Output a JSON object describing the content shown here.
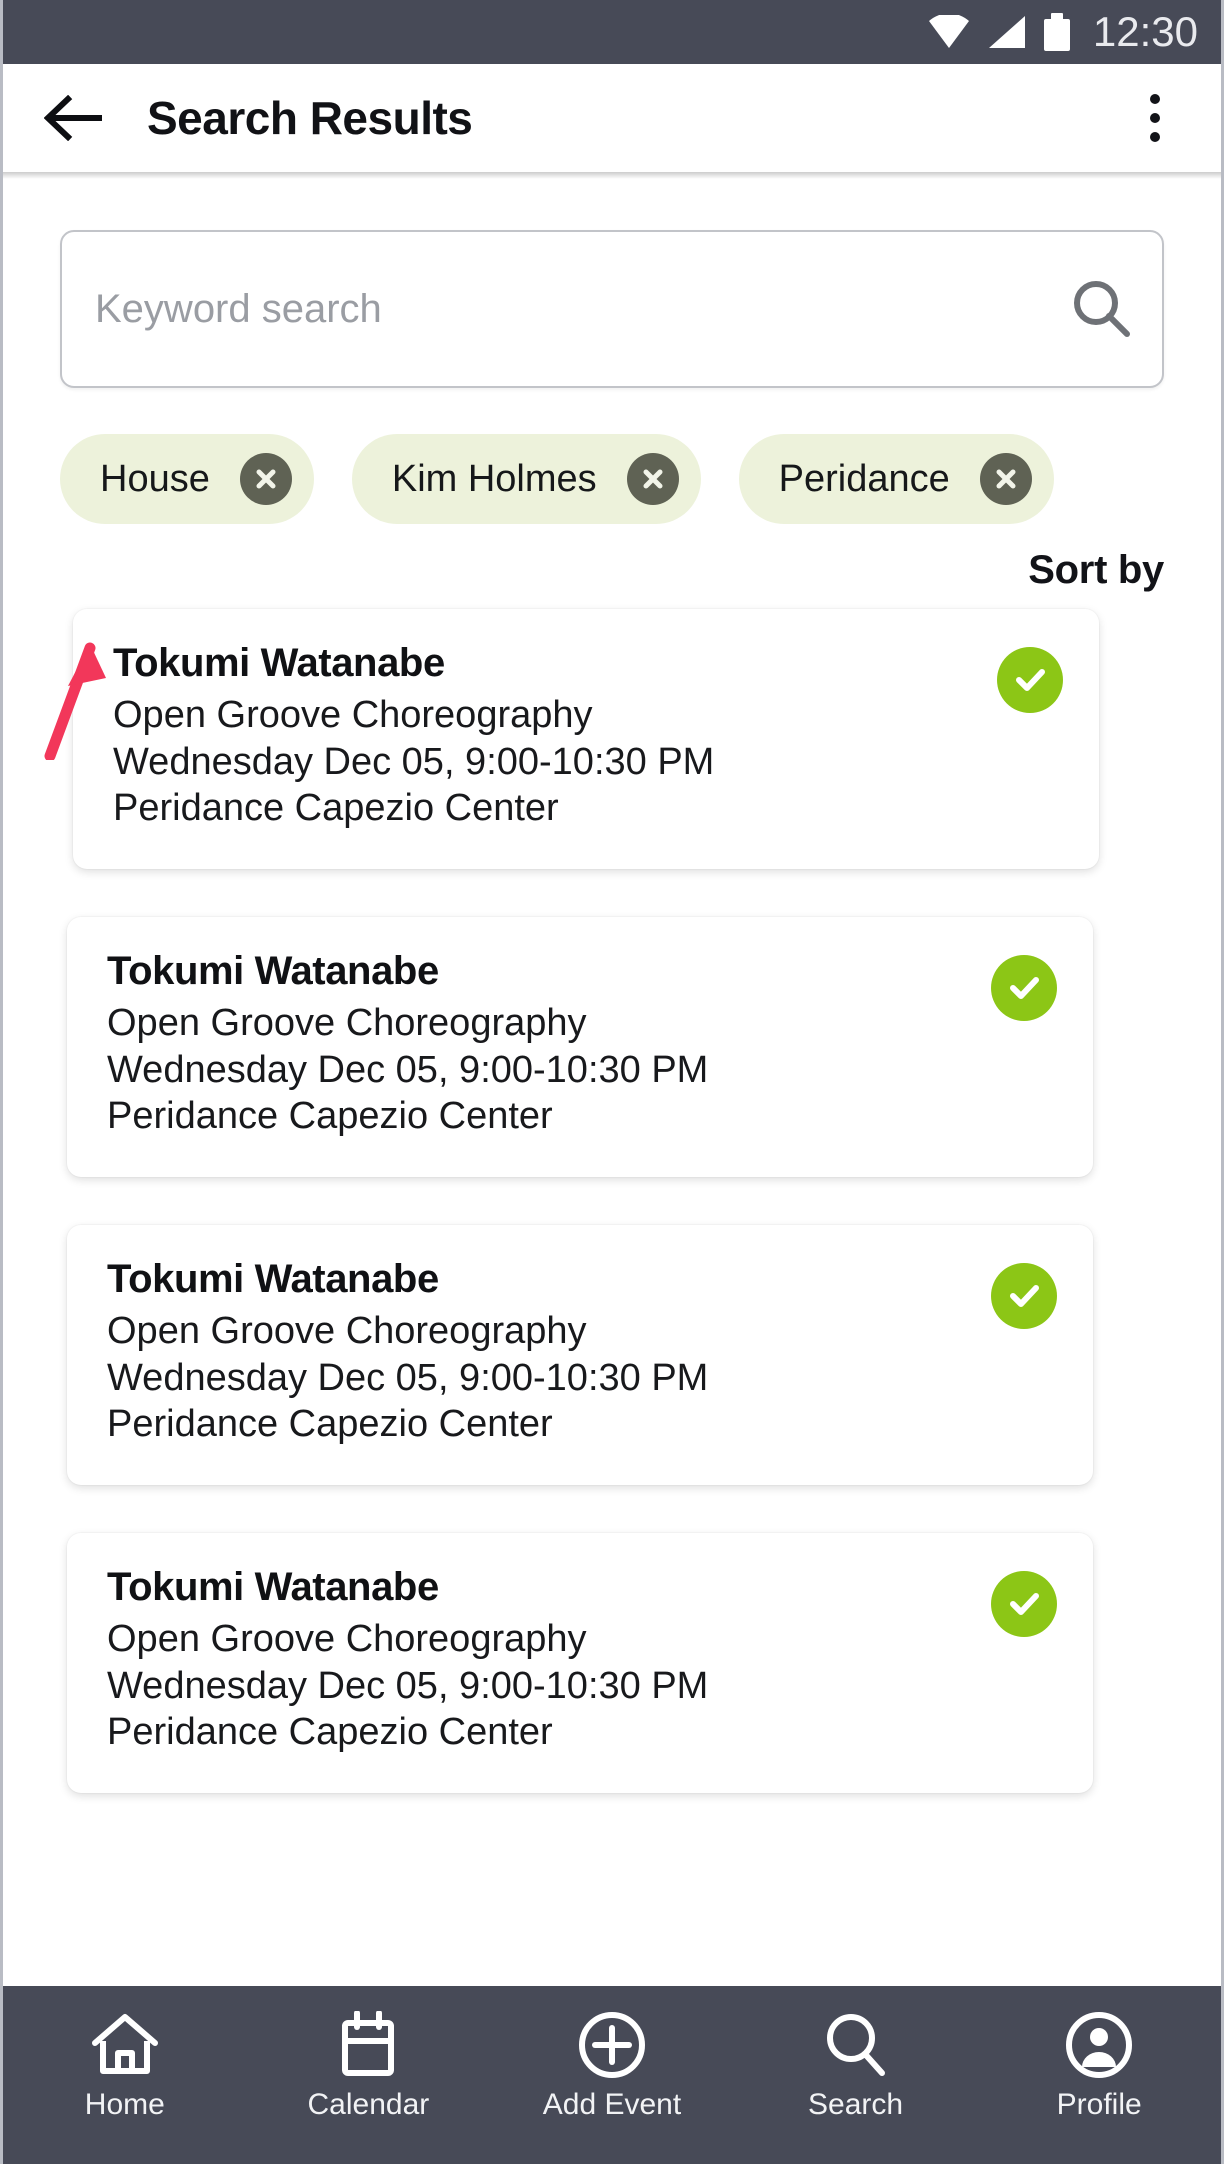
{
  "status_bar": {
    "time": "12:30",
    "icons": [
      "wifi-icon",
      "signal-icon",
      "battery-icon"
    ],
    "background": "#474A57"
  },
  "app_bar": {
    "back_icon": "back-arrow-icon",
    "title": "Search Results",
    "overflow_icon": "more-vertical-icon"
  },
  "search": {
    "placeholder": "Keyword search",
    "value": "",
    "icon": "search-icon"
  },
  "filter_chips": [
    {
      "label": "House",
      "remove_icon": "close-circle-icon"
    },
    {
      "label": "Kim Holmes",
      "remove_icon": "close-circle-icon"
    },
    {
      "label": "Peridance",
      "remove_icon": "close-circle-icon"
    }
  ],
  "sort": {
    "label": "Sort by"
  },
  "annotation": {
    "type": "arrow",
    "color": "#F2375A",
    "points_to": "House filter chip"
  },
  "results": [
    {
      "title": "Tokumi Watanabe",
      "class_name": "Open Groove Choreography",
      "schedule": "Wednesday Dec 05, 9:00-10:30 PM",
      "venue": "Peridance Capezio Center",
      "status_icon": "check-circle-icon",
      "status_color": "#8CC616"
    },
    {
      "title": "Tokumi Watanabe",
      "class_name": "Open Groove Choreography",
      "schedule": "Wednesday Dec 05, 9:00-10:30 PM",
      "venue": "Peridance Capezio Center",
      "status_icon": "check-circle-icon",
      "status_color": "#8CC616"
    },
    {
      "title": "Tokumi Watanabe",
      "class_name": "Open Groove Choreography",
      "schedule": "Wednesday Dec 05, 9:00-10:30 PM",
      "venue": "Peridance Capezio Center",
      "status_icon": "check-circle-icon",
      "status_color": "#8CC616"
    },
    {
      "title": "Tokumi Watanabe",
      "class_name": "Open Groove Choreography",
      "schedule": "Wednesday Dec 05, 9:00-10:30 PM",
      "venue": "Peridance Capezio Center",
      "status_icon": "check-circle-icon",
      "status_color": "#8CC616"
    }
  ],
  "bottom_nav": [
    {
      "label": "Home",
      "icon": "home-icon"
    },
    {
      "label": "Calendar",
      "icon": "calendar-icon"
    },
    {
      "label": "Add Event",
      "icon": "plus-circle-icon"
    },
    {
      "label": "Search",
      "icon": "search-icon"
    },
    {
      "label": "Profile",
      "icon": "person-circle-icon"
    }
  ],
  "theme": {
    "chip_background": "#EDF2DB",
    "chip_remove_bg": "#5F6254",
    "nav_background": "#474A57",
    "accent_green": "#8CC616",
    "annotation_red": "#F2375A"
  }
}
